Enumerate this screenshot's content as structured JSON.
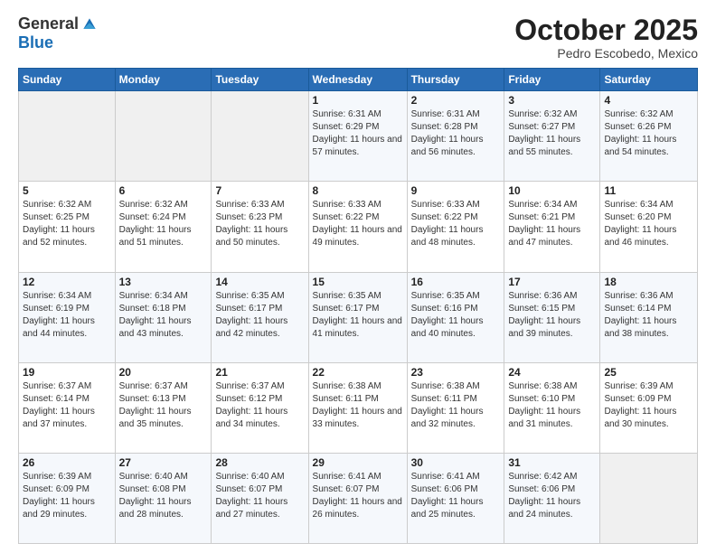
{
  "logo": {
    "general": "General",
    "blue": "Blue"
  },
  "header": {
    "month": "October 2025",
    "location": "Pedro Escobedo, Mexico"
  },
  "weekdays": [
    "Sunday",
    "Monday",
    "Tuesday",
    "Wednesday",
    "Thursday",
    "Friday",
    "Saturday"
  ],
  "weeks": [
    [
      {
        "day": "",
        "sunrise": "",
        "sunset": "",
        "daylight": ""
      },
      {
        "day": "",
        "sunrise": "",
        "sunset": "",
        "daylight": ""
      },
      {
        "day": "",
        "sunrise": "",
        "sunset": "",
        "daylight": ""
      },
      {
        "day": "1",
        "sunrise": "Sunrise: 6:31 AM",
        "sunset": "Sunset: 6:29 PM",
        "daylight": "Daylight: 11 hours and 57 minutes."
      },
      {
        "day": "2",
        "sunrise": "Sunrise: 6:31 AM",
        "sunset": "Sunset: 6:28 PM",
        "daylight": "Daylight: 11 hours and 56 minutes."
      },
      {
        "day": "3",
        "sunrise": "Sunrise: 6:32 AM",
        "sunset": "Sunset: 6:27 PM",
        "daylight": "Daylight: 11 hours and 55 minutes."
      },
      {
        "day": "4",
        "sunrise": "Sunrise: 6:32 AM",
        "sunset": "Sunset: 6:26 PM",
        "daylight": "Daylight: 11 hours and 54 minutes."
      }
    ],
    [
      {
        "day": "5",
        "sunrise": "Sunrise: 6:32 AM",
        "sunset": "Sunset: 6:25 PM",
        "daylight": "Daylight: 11 hours and 52 minutes."
      },
      {
        "day": "6",
        "sunrise": "Sunrise: 6:32 AM",
        "sunset": "Sunset: 6:24 PM",
        "daylight": "Daylight: 11 hours and 51 minutes."
      },
      {
        "day": "7",
        "sunrise": "Sunrise: 6:33 AM",
        "sunset": "Sunset: 6:23 PM",
        "daylight": "Daylight: 11 hours and 50 minutes."
      },
      {
        "day": "8",
        "sunrise": "Sunrise: 6:33 AM",
        "sunset": "Sunset: 6:22 PM",
        "daylight": "Daylight: 11 hours and 49 minutes."
      },
      {
        "day": "9",
        "sunrise": "Sunrise: 6:33 AM",
        "sunset": "Sunset: 6:22 PM",
        "daylight": "Daylight: 11 hours and 48 minutes."
      },
      {
        "day": "10",
        "sunrise": "Sunrise: 6:34 AM",
        "sunset": "Sunset: 6:21 PM",
        "daylight": "Daylight: 11 hours and 47 minutes."
      },
      {
        "day": "11",
        "sunrise": "Sunrise: 6:34 AM",
        "sunset": "Sunset: 6:20 PM",
        "daylight": "Daylight: 11 hours and 46 minutes."
      }
    ],
    [
      {
        "day": "12",
        "sunrise": "Sunrise: 6:34 AM",
        "sunset": "Sunset: 6:19 PM",
        "daylight": "Daylight: 11 hours and 44 minutes."
      },
      {
        "day": "13",
        "sunrise": "Sunrise: 6:34 AM",
        "sunset": "Sunset: 6:18 PM",
        "daylight": "Daylight: 11 hours and 43 minutes."
      },
      {
        "day": "14",
        "sunrise": "Sunrise: 6:35 AM",
        "sunset": "Sunset: 6:17 PM",
        "daylight": "Daylight: 11 hours and 42 minutes."
      },
      {
        "day": "15",
        "sunrise": "Sunrise: 6:35 AM",
        "sunset": "Sunset: 6:17 PM",
        "daylight": "Daylight: 11 hours and 41 minutes."
      },
      {
        "day": "16",
        "sunrise": "Sunrise: 6:35 AM",
        "sunset": "Sunset: 6:16 PM",
        "daylight": "Daylight: 11 hours and 40 minutes."
      },
      {
        "day": "17",
        "sunrise": "Sunrise: 6:36 AM",
        "sunset": "Sunset: 6:15 PM",
        "daylight": "Daylight: 11 hours and 39 minutes."
      },
      {
        "day": "18",
        "sunrise": "Sunrise: 6:36 AM",
        "sunset": "Sunset: 6:14 PM",
        "daylight": "Daylight: 11 hours and 38 minutes."
      }
    ],
    [
      {
        "day": "19",
        "sunrise": "Sunrise: 6:37 AM",
        "sunset": "Sunset: 6:14 PM",
        "daylight": "Daylight: 11 hours and 37 minutes."
      },
      {
        "day": "20",
        "sunrise": "Sunrise: 6:37 AM",
        "sunset": "Sunset: 6:13 PM",
        "daylight": "Daylight: 11 hours and 35 minutes."
      },
      {
        "day": "21",
        "sunrise": "Sunrise: 6:37 AM",
        "sunset": "Sunset: 6:12 PM",
        "daylight": "Daylight: 11 hours and 34 minutes."
      },
      {
        "day": "22",
        "sunrise": "Sunrise: 6:38 AM",
        "sunset": "Sunset: 6:11 PM",
        "daylight": "Daylight: 11 hours and 33 minutes."
      },
      {
        "day": "23",
        "sunrise": "Sunrise: 6:38 AM",
        "sunset": "Sunset: 6:11 PM",
        "daylight": "Daylight: 11 hours and 32 minutes."
      },
      {
        "day": "24",
        "sunrise": "Sunrise: 6:38 AM",
        "sunset": "Sunset: 6:10 PM",
        "daylight": "Daylight: 11 hours and 31 minutes."
      },
      {
        "day": "25",
        "sunrise": "Sunrise: 6:39 AM",
        "sunset": "Sunset: 6:09 PM",
        "daylight": "Daylight: 11 hours and 30 minutes."
      }
    ],
    [
      {
        "day": "26",
        "sunrise": "Sunrise: 6:39 AM",
        "sunset": "Sunset: 6:09 PM",
        "daylight": "Daylight: 11 hours and 29 minutes."
      },
      {
        "day": "27",
        "sunrise": "Sunrise: 6:40 AM",
        "sunset": "Sunset: 6:08 PM",
        "daylight": "Daylight: 11 hours and 28 minutes."
      },
      {
        "day": "28",
        "sunrise": "Sunrise: 6:40 AM",
        "sunset": "Sunset: 6:07 PM",
        "daylight": "Daylight: 11 hours and 27 minutes."
      },
      {
        "day": "29",
        "sunrise": "Sunrise: 6:41 AM",
        "sunset": "Sunset: 6:07 PM",
        "daylight": "Daylight: 11 hours and 26 minutes."
      },
      {
        "day": "30",
        "sunrise": "Sunrise: 6:41 AM",
        "sunset": "Sunset: 6:06 PM",
        "daylight": "Daylight: 11 hours and 25 minutes."
      },
      {
        "day": "31",
        "sunrise": "Sunrise: 6:42 AM",
        "sunset": "Sunset: 6:06 PM",
        "daylight": "Daylight: 11 hours and 24 minutes."
      },
      {
        "day": "",
        "sunrise": "",
        "sunset": "",
        "daylight": ""
      }
    ]
  ]
}
